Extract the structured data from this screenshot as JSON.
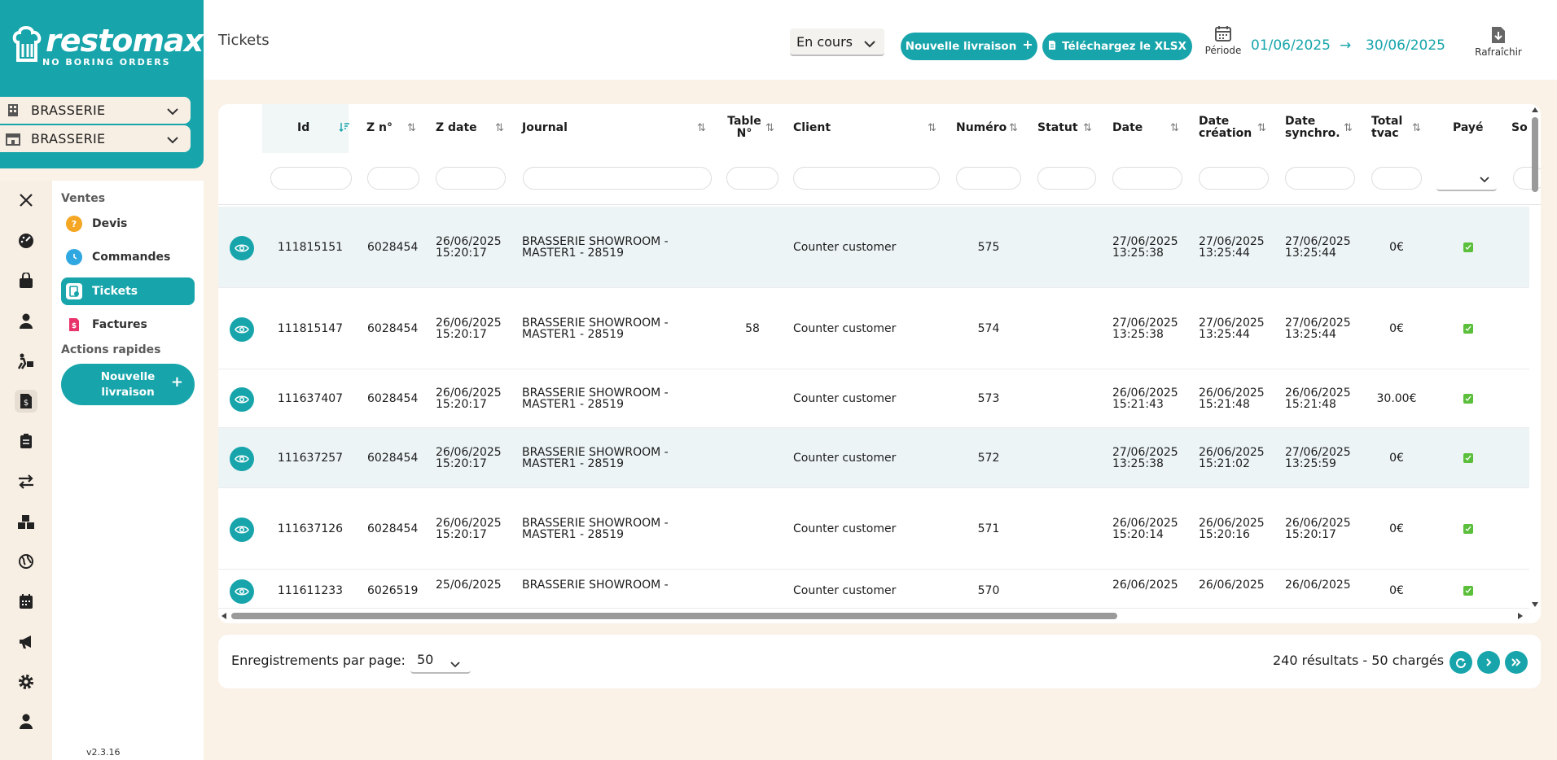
{
  "brand": {
    "name": "restomax",
    "tagline": "NO BORING ORDERS"
  },
  "establishments": [
    {
      "label": "BRASSERIE",
      "icon": "building-icon"
    },
    {
      "label": "BRASSERIE",
      "icon": "store-icon"
    }
  ],
  "rail_icons": [
    "close-icon",
    "dashboard-icon",
    "bag-icon",
    "user-icon",
    "delivery-icon",
    "invoice-icon",
    "clipboard-icon",
    "transfer-icon",
    "boxes-icon",
    "globe-icon",
    "calendar-icon",
    "megaphone-icon",
    "gear-icon",
    "profile-icon"
  ],
  "menu": {
    "section_sales": "Ventes",
    "items": [
      {
        "label": "Devis",
        "icon": "quote-icon"
      },
      {
        "label": "Commandes",
        "icon": "clock-icon"
      },
      {
        "label": "Tickets",
        "icon": "ticket-icon"
      },
      {
        "label": "Factures",
        "icon": "invoice-icon"
      }
    ],
    "section_quick": "Actions rapides",
    "quick_label_1": "Nouvelle",
    "quick_label_2": "livraison",
    "quick_plus": "+"
  },
  "version": "v2.3.16",
  "header": {
    "title": "Tickets",
    "status_value": "En cours",
    "new_delivery": "Nouvelle livraison",
    "download": "Téléchargez le XLSX",
    "period_label": "Période",
    "date_from": "01/06/2025",
    "date_arrow": "→",
    "date_to": "30/06/2025",
    "refresh_label": "Rafraîchir"
  },
  "table": {
    "columns": [
      {
        "label": "Id"
      },
      {
        "label": "Z n°"
      },
      {
        "label": "Z date"
      },
      {
        "label": "Journal"
      },
      {
        "label1": "Table",
        "label2": "N°"
      },
      {
        "label": "Client"
      },
      {
        "label": "Numéro"
      },
      {
        "label": "Statut"
      },
      {
        "label": "Date"
      },
      {
        "label1": "Date",
        "label2": "création"
      },
      {
        "label1": "Date",
        "label2": "synchro."
      },
      {
        "label1": "Total",
        "label2": "tvac"
      },
      {
        "label": "Payé"
      },
      {
        "label": "So"
      }
    ],
    "rows": [
      {
        "id": "111815151",
        "z": "6028454",
        "zdate1": "26/06/2025",
        "zdate2": "15:20:17",
        "journal1": "BRASSERIE SHOWROOM -",
        "journal2": "MASTER1 - 28519",
        "table": "",
        "client": "Counter customer",
        "numero": "575",
        "statut": "",
        "date1": "27/06/2025",
        "date2": "13:25:38",
        "cre1": "27/06/2025",
        "cre2": "13:25:44",
        "syn1": "27/06/2025",
        "syn2": "13:25:44",
        "total": "0€"
      },
      {
        "id": "111815147",
        "z": "6028454",
        "zdate1": "26/06/2025",
        "zdate2": "15:20:17",
        "journal1": "BRASSERIE SHOWROOM -",
        "journal2": "MASTER1 - 28519",
        "table": "58",
        "client": "Counter customer",
        "numero": "574",
        "statut": "",
        "date1": "27/06/2025",
        "date2": "13:25:38",
        "cre1": "27/06/2025",
        "cre2": "13:25:44",
        "syn1": "27/06/2025",
        "syn2": "13:25:44",
        "total": "0€"
      },
      {
        "id": "111637407",
        "z": "6028454",
        "zdate1": "26/06/2025",
        "zdate2": "15:20:17",
        "journal1": "BRASSERIE SHOWROOM -",
        "journal2": "MASTER1 - 28519",
        "table": "",
        "client": "Counter customer",
        "numero": "573",
        "statut": "",
        "date1": "26/06/2025",
        "date2": "15:21:43",
        "cre1": "26/06/2025",
        "cre2": "15:21:48",
        "syn1": "26/06/2025",
        "syn2": "15:21:48",
        "total": "30.00€"
      },
      {
        "id": "111637257",
        "z": "6028454",
        "zdate1": "26/06/2025",
        "zdate2": "15:20:17",
        "journal1": "BRASSERIE SHOWROOM -",
        "journal2": "MASTER1 - 28519",
        "table": "",
        "client": "Counter customer",
        "numero": "572",
        "statut": "",
        "date1": "27/06/2025",
        "date2": "13:25:38",
        "cre1": "26/06/2025",
        "cre2": "15:21:02",
        "syn1": "27/06/2025",
        "syn2": "13:25:59",
        "total": "0€"
      },
      {
        "id": "111637126",
        "z": "6028454",
        "zdate1": "26/06/2025",
        "zdate2": "15:20:17",
        "journal1": "BRASSERIE SHOWROOM -",
        "journal2": "MASTER1 - 28519",
        "table": "",
        "client": "Counter customer",
        "numero": "571",
        "statut": "",
        "date1": "26/06/2025",
        "date2": "15:20:14",
        "cre1": "26/06/2025",
        "cre2": "15:20:16",
        "syn1": "26/06/2025",
        "syn2": "15:20:17",
        "total": "0€"
      },
      {
        "id": "111611233",
        "z": "6026519",
        "zdate1": "25/06/2025",
        "zdate2": "",
        "journal1": "BRASSERIE SHOWROOM -",
        "journal2": "",
        "table": "",
        "client": "Counter customer",
        "numero": "570",
        "statut": "",
        "date1": "26/06/2025",
        "date2": "",
        "cre1": "26/06/2025",
        "cre2": "",
        "syn1": "26/06/2025",
        "syn2": "",
        "total": "0€"
      }
    ]
  },
  "footer": {
    "per_page_label": "Enregistrements par page:",
    "per_page_value": "50",
    "results": "240 résultats - 50 chargés"
  },
  "colors": {
    "accent": "#17a5ab",
    "background": "#faf1e7",
    "paid": "#5bbf3b"
  }
}
